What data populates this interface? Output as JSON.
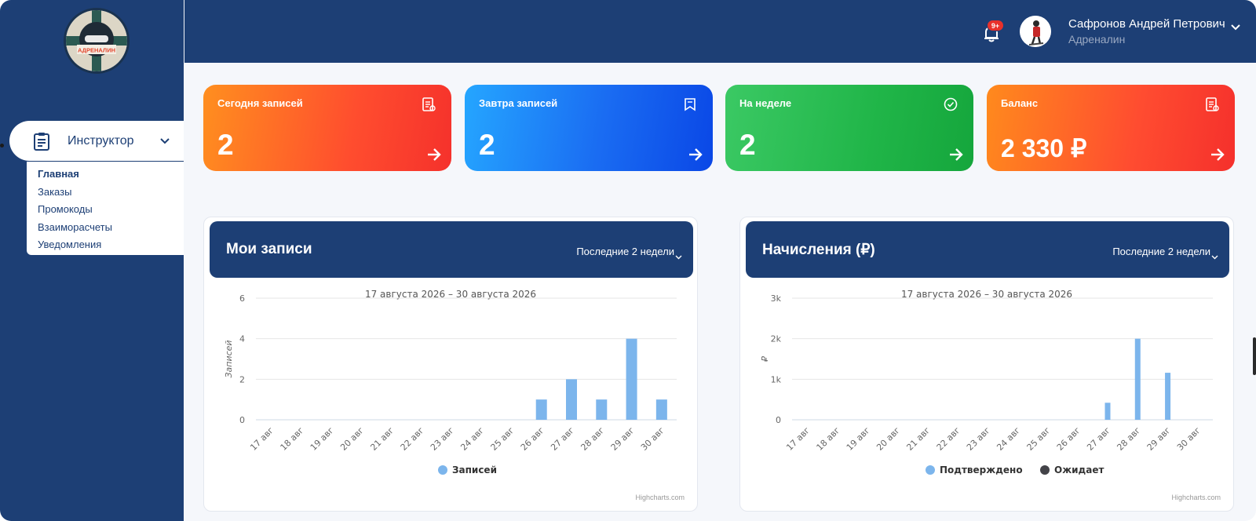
{
  "sidebar": {
    "logo_text": "АДРЕНАЛИН",
    "menu": {
      "label": "Инструктор"
    },
    "submenu": [
      {
        "label": "Главная",
        "active": true
      },
      {
        "label": "Заказы"
      },
      {
        "label": "Промокоды"
      },
      {
        "label": "Взаиморасчеты"
      },
      {
        "label": "Уведомления"
      }
    ]
  },
  "header": {
    "notifications_badge": "9+",
    "user_name": "Сафронов Андрей Петрович",
    "user_org": "Адреналин"
  },
  "stats": [
    {
      "title": "Сегодня записей",
      "value": "2",
      "icon": "document-icon"
    },
    {
      "title": "Завтра записей",
      "value": "2",
      "icon": "bookmark-icon"
    },
    {
      "title": "На неделе",
      "value": "2",
      "icon": "check-circle-icon"
    },
    {
      "title": "Баланс",
      "value": "2 330 ₽",
      "icon": "document-icon"
    }
  ],
  "colors": {
    "navy": "#1d3f75",
    "series_blue": "#7cb5ec",
    "series_dark": "#434348"
  },
  "panels": {
    "bookings": {
      "title": "Мои записи",
      "period": "Последние 2 недели"
    },
    "earnings": {
      "title": "Начисления (₽)",
      "period": "Последние 2 недели"
    }
  },
  "chart_data": [
    {
      "type": "bar",
      "title": "",
      "subtitle": "17 августа 2026 – 30 августа 2026",
      "xlabel": "",
      "ylabel": "Записей",
      "ylim": [
        0,
        6
      ],
      "yticks": [
        "0",
        "2",
        "4",
        "6"
      ],
      "categories": [
        "17 авг",
        "18 авг",
        "19 авг",
        "20 авг",
        "21 авг",
        "22 авг",
        "23 авг",
        "24 авг",
        "25 авг",
        "26 авг",
        "27 авг",
        "28 авг",
        "29 авг",
        "30 авг"
      ],
      "series": [
        {
          "name": "Записей",
          "values": [
            0,
            0,
            0,
            0,
            0,
            0,
            0,
            0,
            0,
            1,
            2,
            1,
            4,
            1
          ]
        }
      ],
      "credit": "Highcharts.com",
      "grid": true,
      "legend": "bottom-center"
    },
    {
      "type": "bar",
      "title": "",
      "subtitle": "17 августа 2026 – 30 августа 2026",
      "xlabel": "",
      "ylabel": "₽",
      "ylim": [
        0,
        3000
      ],
      "yticks": [
        "0",
        "1k",
        "2k",
        "3k"
      ],
      "categories": [
        "17 авг",
        "18 авг",
        "19 авг",
        "20 авг",
        "21 авг",
        "22 авг",
        "23 авг",
        "24 авг",
        "25 авг",
        "26 авг",
        "27 авг",
        "28 авг",
        "29 авг",
        "30 авг"
      ],
      "series": [
        {
          "name": "Подтверждено",
          "values": [
            0,
            0,
            0,
            0,
            0,
            0,
            0,
            0,
            0,
            0,
            420,
            2000,
            1160,
            0
          ]
        },
        {
          "name": "Ожидает",
          "values": [
            0,
            0,
            0,
            0,
            0,
            0,
            0,
            0,
            0,
            0,
            0,
            0,
            0,
            0
          ]
        }
      ],
      "credit": "Highcharts.com",
      "grid": true,
      "legend": "bottom-center"
    }
  ]
}
